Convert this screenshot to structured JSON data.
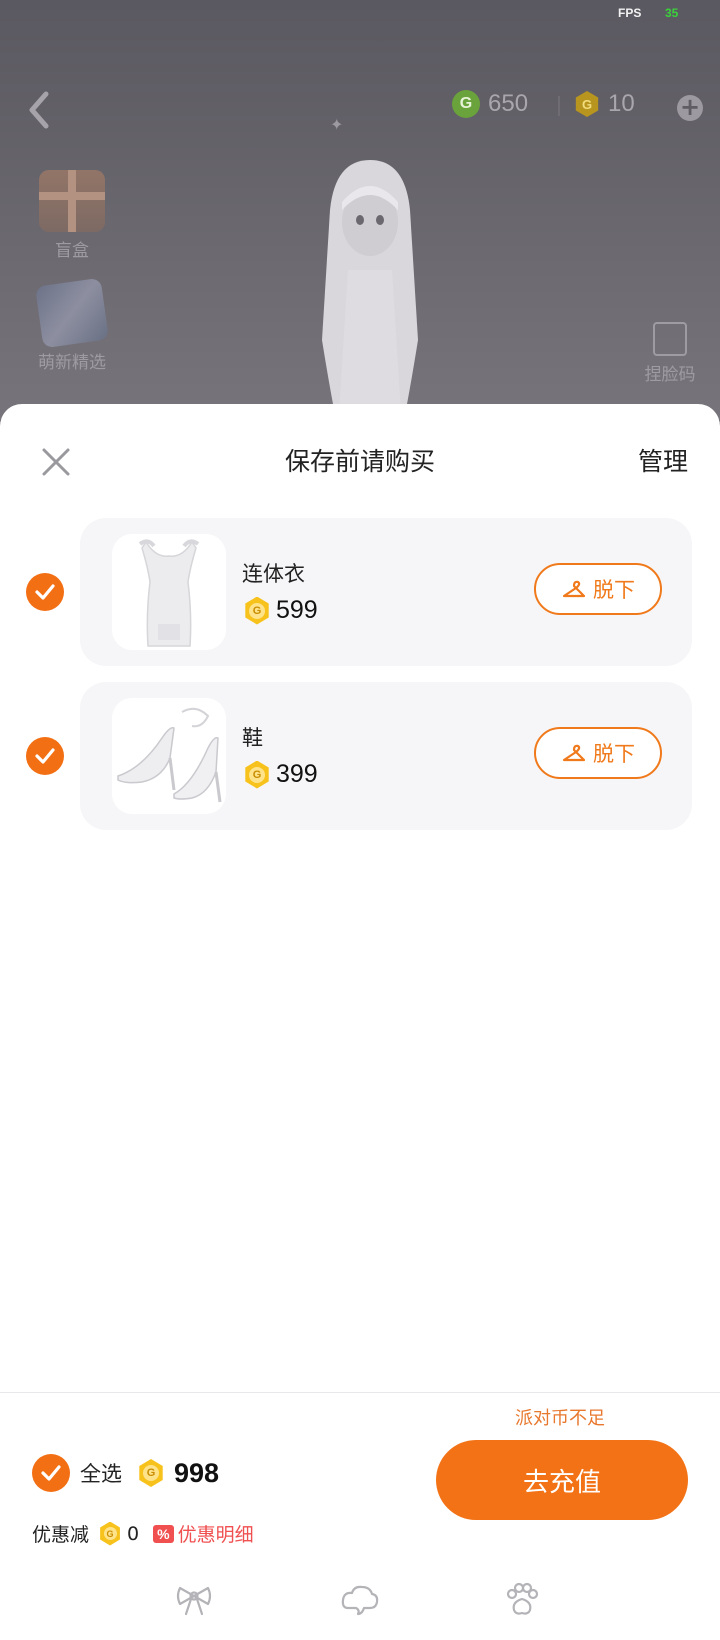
{
  "status": {
    "fps_label": "FPS",
    "fps_value": "35"
  },
  "top_bar": {
    "green_currency": "650",
    "gold_currency": "10"
  },
  "side_menu": {
    "blind_box_label": "盲盒",
    "new_arrivals_label": "萌新精选",
    "photo_code_label": "捏脸码"
  },
  "sheet": {
    "title": "保存前请购买",
    "manage_label": "管理",
    "items": [
      {
        "name": "连体衣",
        "price": "599",
        "action_label": "脱下"
      },
      {
        "name": "鞋",
        "price": "399",
        "action_label": "脱下"
      }
    ]
  },
  "footer": {
    "insufficient_notice": "派对币不足",
    "select_all_label": "全选",
    "total": "998",
    "discount_label": "优惠减",
    "discount_value": "0",
    "discount_tag": "%",
    "discount_detail_label": "优惠明细",
    "recharge_label": "去充值"
  },
  "colors": {
    "accent": "#f37215",
    "coin": "#f7c21b",
    "discount": "#f05050"
  },
  "icons": [
    "back-arrow-icon",
    "plus-icon",
    "close-icon",
    "check-icon",
    "hanger-icon",
    "bow-icon",
    "cloud-icon",
    "paw-icon"
  ]
}
